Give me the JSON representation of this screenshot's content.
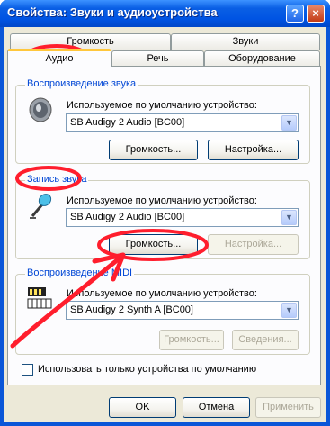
{
  "window": {
    "title": "Свойства: Звуки и аудиоустройства",
    "help_glyph": "?",
    "close_glyph": "×"
  },
  "tabs": {
    "row_top": [
      {
        "label": "Громкость"
      },
      {
        "label": "Звуки"
      }
    ],
    "row_bottom": [
      {
        "label": "Аудио"
      },
      {
        "label": "Речь"
      },
      {
        "label": "Оборудование"
      }
    ],
    "active": "Аудио"
  },
  "playback": {
    "group_title": "Воспроизведение звука",
    "device_label": "Используемое по умолчанию устройство:",
    "device_value": "SB Audigy 2 Audio [BC00]",
    "volume_button": "Громкость...",
    "settings_button": "Настройка...",
    "icon": "speaker-icon"
  },
  "recording": {
    "group_title": "Запись звука",
    "device_label": "Используемое по умолчанию устройство:",
    "device_value": "SB Audigy 2 Audio [BC00]",
    "volume_button": "Громкость...",
    "settings_button": "Настройка...",
    "settings_disabled": true,
    "icon": "microphone-icon"
  },
  "midi": {
    "group_title": "Воспроизведение MIDI",
    "device_label": "Используемое по умолчанию устройство:",
    "device_value": "SB Audigy 2 Synth A [BC00]",
    "volume_button": "Громкость...",
    "about_button": "Сведения...",
    "buttons_disabled": true,
    "icon": "midi-keyboard-icon"
  },
  "default_only_checkbox": {
    "label": "Использовать только устройства по умолчанию",
    "checked": false
  },
  "footer": {
    "ok": "OK",
    "cancel": "Отмена",
    "apply": "Применить",
    "apply_disabled": true
  },
  "colors": {
    "titlebar": "#0054e3",
    "group_title": "#0046d5",
    "annotation": "#ff1e2d",
    "tab_highlight": "#ffc73c"
  }
}
